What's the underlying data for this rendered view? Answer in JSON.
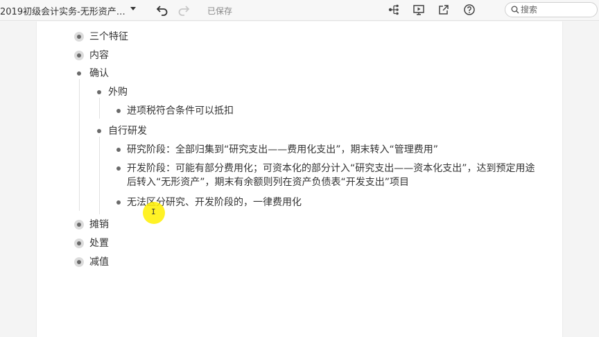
{
  "toolbar": {
    "doc_title": "2019初级会计实务-无形资产…",
    "saved_status": "已保存",
    "search_placeholder": "搜索",
    "icons": [
      "chevron-down-icon",
      "undo-icon",
      "redo-icon",
      "mindmap-icon",
      "present-icon",
      "share-icon",
      "help-icon",
      "search-icon"
    ]
  },
  "outline": {
    "n1": "三个特征",
    "n2": "内容",
    "n3": "确认",
    "n3_1": "外购",
    "n3_1_1": "进项税符合条件可以抵扣",
    "n3_2": "自行研发",
    "n3_2_1": "研究阶段：全部归集到“研究支出——费用化支出”，期末转入“管理费用”",
    "n3_2_2_line1": "开发阶段：可能有部分费用化；可资本化的部分计入“研究支出——资本化支出”，达到预定用途",
    "n3_2_2_line2": "后转入“无形资产”，期末有余额则列在资产负债表“开发支出”项目",
    "n3_2_3": "无法区分研究、开发阶段的，一律费用化",
    "n4": "摊销",
    "n5": "处置",
    "n6": "减值"
  },
  "colors": {
    "highlight": "#fff000",
    "bullet": "#6a6a6a",
    "bullet_ring": "#dcdcdc"
  }
}
